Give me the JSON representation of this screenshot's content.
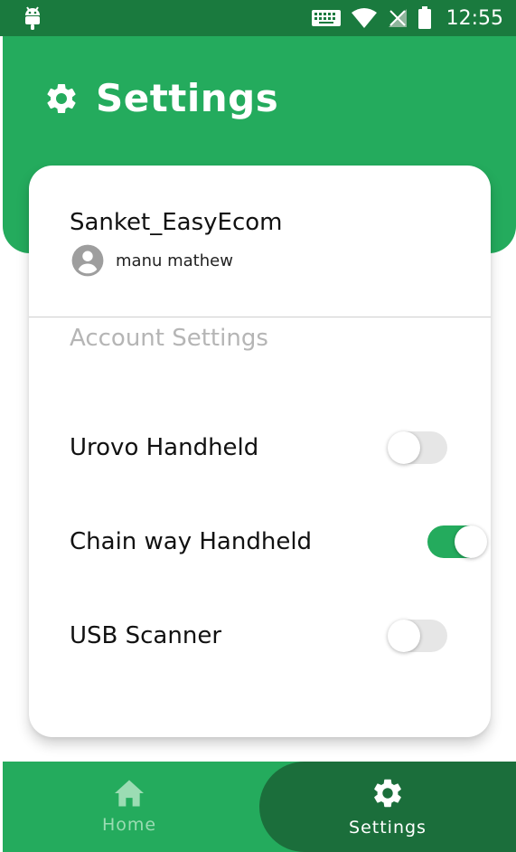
{
  "status_bar": {
    "time": "12:55",
    "icons": [
      "android-icon",
      "keyboard-icon",
      "wifi-icon",
      "no-signal-icon",
      "battery-icon"
    ]
  },
  "header": {
    "title": "Settings",
    "icon": "gear-icon"
  },
  "account": {
    "store_name": "Sanket_EasyEcom",
    "user_name": "manu mathew",
    "avatar_icon": "account-circle-icon"
  },
  "settings": {
    "section_title": "Account Settings",
    "items": [
      {
        "label": "Urovo Handheld",
        "enabled": false
      },
      {
        "label": "Chain way Handheld",
        "enabled": true
      },
      {
        "label": "USB Scanner",
        "enabled": false
      }
    ]
  },
  "bottom_nav": {
    "items": [
      {
        "label": "Home",
        "icon": "home-icon",
        "active": false
      },
      {
        "label": "Settings",
        "icon": "gear-icon",
        "active": true
      }
    ]
  },
  "colors": {
    "status_bar": "#1a7a3e",
    "primary": "#24ab5d",
    "nav_active": "#1b6e3b",
    "section_title": "#b5b5b5"
  }
}
